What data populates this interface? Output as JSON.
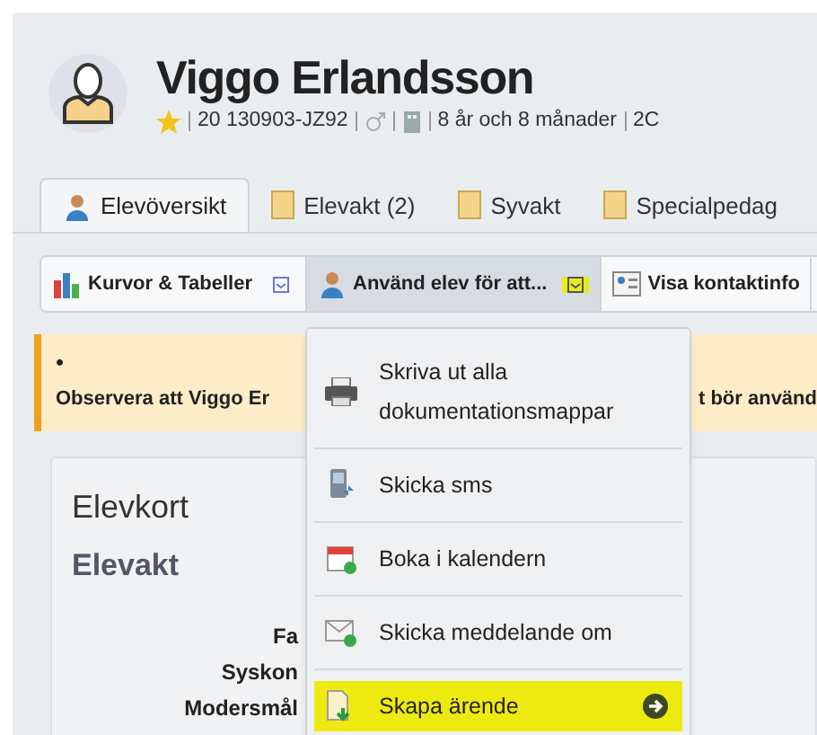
{
  "student": {
    "name": "Viggo Erlandsson",
    "starred": true,
    "id": "20 130903-JZ92",
    "age": "8 år och 8 månader",
    "class": "2C"
  },
  "tabs": [
    {
      "label": "Elevöversikt",
      "kind": "person",
      "selected": true
    },
    {
      "label": "Elevakt (2)",
      "kind": "folder",
      "selected": false
    },
    {
      "label": "Syvakt",
      "kind": "folder",
      "selected": false
    },
    {
      "label": "Specialpedag",
      "kind": "folder",
      "selected": false
    }
  ],
  "toolbar": [
    {
      "label": "Kurvor & Tabeller",
      "kind": "chart",
      "dropdown": true,
      "open": false
    },
    {
      "label": "Använd elev för att...",
      "kind": "person",
      "dropdown": true,
      "open": true
    },
    {
      "label": "Visa kontaktinfo",
      "kind": "card",
      "dropdown": false,
      "open": false
    }
  ],
  "alert": {
    "bullet": "•",
    "text_start": "Observera att Viggo Er",
    "text_end": "t bör använd"
  },
  "card": {
    "title": "Elevkort",
    "section": "Elevakt",
    "fields": [
      "Fa",
      "Syskon",
      "Modersmål"
    ]
  },
  "menu": [
    {
      "label": "Skriva ut alla dokumentationsmappar",
      "kind": "printer",
      "selected": false
    },
    {
      "label": "Skicka sms",
      "kind": "phone",
      "selected": false
    },
    {
      "label": "Boka i kalendern",
      "kind": "calendar",
      "selected": false
    },
    {
      "label": "Skicka meddelande om",
      "kind": "mail",
      "selected": false
    },
    {
      "label": "Skapa ärende",
      "kind": "document",
      "selected": true
    }
  ]
}
